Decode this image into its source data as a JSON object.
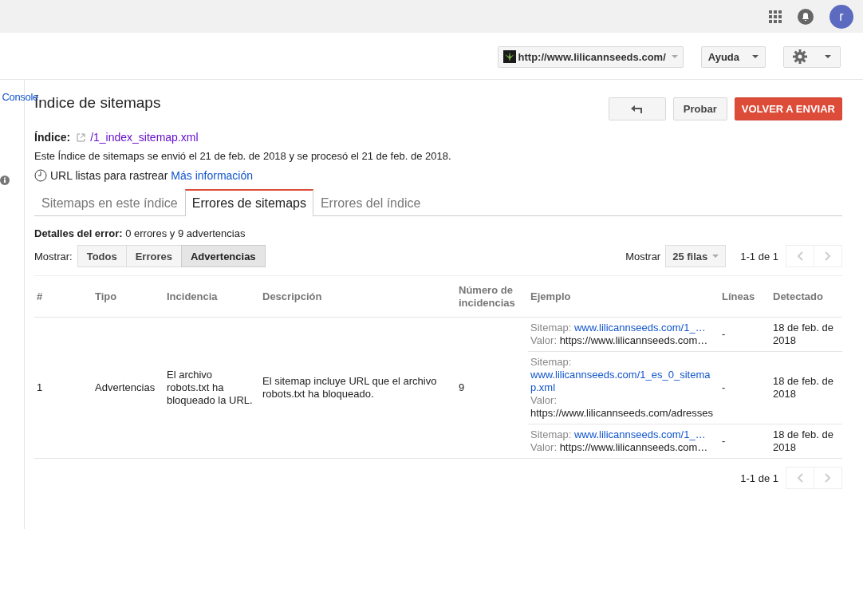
{
  "topbar": {
    "avatar": "r"
  },
  "header": {
    "site": "http://www.lilicannseeds.com/",
    "help": "Ayuda"
  },
  "sidebar": {
    "label": "Console"
  },
  "page": {
    "title": "Índice de sitemaps",
    "buttons": {
      "test": "Probar",
      "resubmit": "VOLVER A ENVIAR"
    }
  },
  "index": {
    "label": "Índice:",
    "link": "/1_index_sitemap.xml",
    "summary": "Este Índice de sitemaps se envió el 21 de feb. de 2018 y se procesó el 21 de feb. de 2018.",
    "status": "URL listas para rastrear",
    "more": "Más información"
  },
  "tabs": [
    {
      "label": "Sitemaps en este índice",
      "selected": false
    },
    {
      "label": "Errores de sitemaps",
      "selected": true
    },
    {
      "label": "Errores del índice",
      "selected": false
    }
  ],
  "details": "**Detalles del error:** 0 errores y 9 advertencias",
  "filter": {
    "label": "Mostrar:",
    "options": [
      {
        "label": "Todos",
        "selected": false
      },
      {
        "label": "Errores",
        "selected": false
      },
      {
        "label": "Advertencias",
        "selected": true
      }
    ]
  },
  "pager": {
    "label": "Mostrar",
    "rows": "25 filas",
    "range": "1-1 de 1"
  },
  "table": {
    "columns": [
      "#",
      "Tipo",
      "Incidencia",
      "Descripción",
      "Número de incidencias",
      "Ejemplo",
      "Líneas",
      "Detectado"
    ],
    "rows": [
      {
        "num": "1",
        "type": "Advertencias",
        "issue": "El archivo robots.txt ha bloqueado la URL.",
        "description": "El sitemap incluye URL que el archivo robots.txt ha bloqueado.",
        "count": "9",
        "examples": [
          {
            "sitemap_label": "Sitemap:",
            "sitemap": "www.lilicannseeds.com/1_…",
            "value_label": "Valor:",
            "value": "https://www.lilicannseeds.com…",
            "lines": "-",
            "detected": "18 de feb. de 2018",
            "wrapped": false
          },
          {
            "sitemap_label": "Sitemap:",
            "sitemap": "www.lilicannseeds.com/1_es_0_sitemap.xml",
            "value_label": "Valor:",
            "value": "https://www.lilicannseeds.com/adresses",
            "lines": "-",
            "detected": "18 de feb. de 2018",
            "wrapped": true
          },
          {
            "sitemap_label": "Sitemap:",
            "sitemap": "www.lilicannseeds.com/1_…",
            "value_label": "Valor:",
            "value": "https://www.lilicannseeds.com…",
            "lines": "-",
            "detected": "18 de feb. de 2018",
            "wrapped": false
          }
        ]
      }
    ]
  },
  "footer_pager": {
    "range": "1-1 de 1"
  }
}
